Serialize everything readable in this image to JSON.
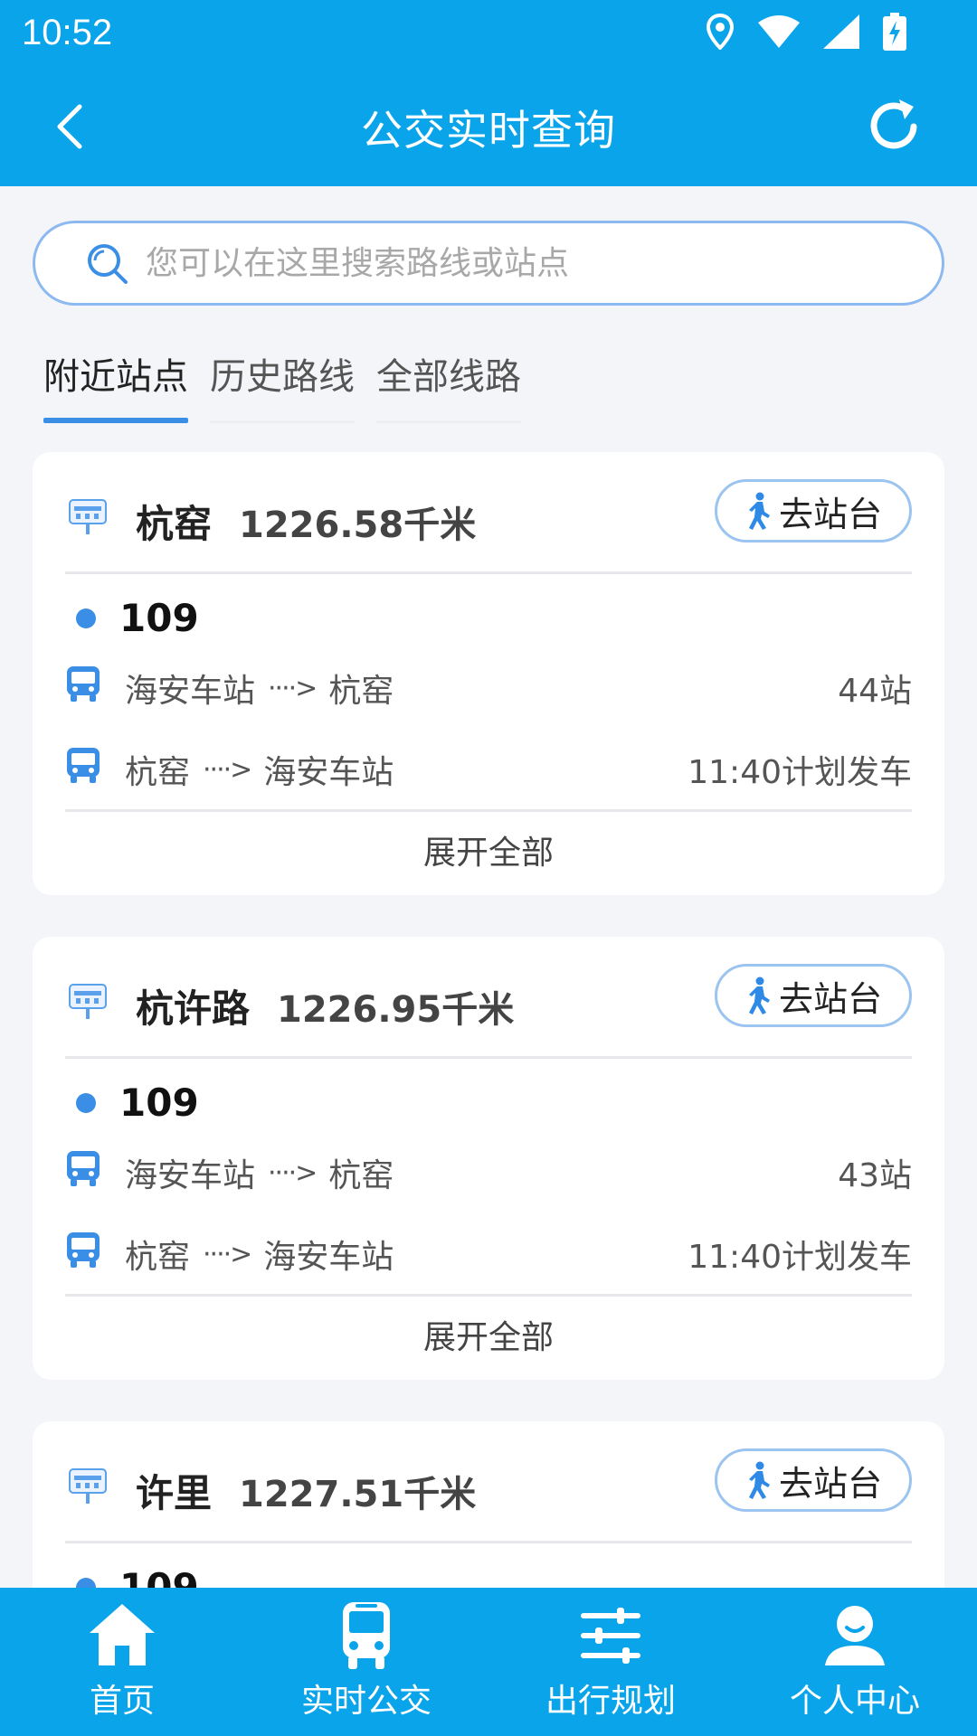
{
  "status_bar": {
    "time": "10:52"
  },
  "header": {
    "title": "公交实时查询"
  },
  "search": {
    "placeholder": "您可以在这里搜索路线或站点"
  },
  "tabs": [
    {
      "label": "附近站点",
      "active": true
    },
    {
      "label": "历史路线",
      "active": false
    },
    {
      "label": "全部线路",
      "active": false
    }
  ],
  "go_station_label": "去站台",
  "expand_label": "展开全部",
  "stops": [
    {
      "name": "杭窑",
      "distance": "1226.58千米",
      "route": "109",
      "dirs": [
        {
          "from": "海安车站",
          "to": "杭窑",
          "info": "44站"
        },
        {
          "from": "杭窑",
          "to": "海安车站",
          "info": "11:40计划发车"
        }
      ]
    },
    {
      "name": "杭许路",
      "distance": "1226.95千米",
      "route": "109",
      "dirs": [
        {
          "from": "海安车站",
          "to": "杭窑",
          "info": "43站"
        },
        {
          "from": "杭窑",
          "to": "海安车站",
          "info": "11:40计划发车"
        }
      ]
    },
    {
      "name": "许里",
      "distance": "1227.51千米",
      "route": "109"
    }
  ],
  "bottom_nav": [
    {
      "label": "首页",
      "icon": "home-icon"
    },
    {
      "label": "实时公交",
      "icon": "bus-icon"
    },
    {
      "label": "出行规划",
      "icon": "sliders-icon"
    },
    {
      "label": "个人中心",
      "icon": "user-icon"
    }
  ],
  "colors": {
    "primary": "#0aa4ea",
    "accent": "#3b8ee6"
  }
}
